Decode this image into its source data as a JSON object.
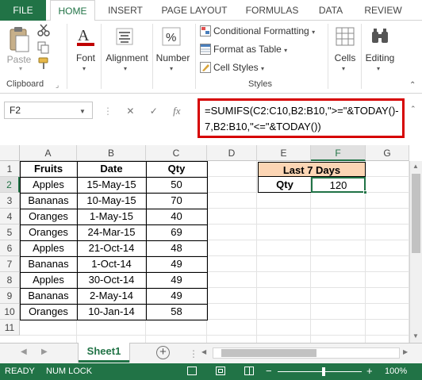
{
  "ribbon_tabs": [
    "FILE",
    "HOME",
    "INSERT",
    "PAGE LAYOUT",
    "FORMULAS",
    "DATA",
    "REVIEW"
  ],
  "active_tab": "HOME",
  "ribbon": {
    "paste_label": "Paste",
    "clipboard_label": "Clipboard",
    "font_label": "Font",
    "alignment_label": "Alignment",
    "number_label": "Number",
    "conditional_formatting": "Conditional Formatting",
    "format_as_table": "Format as Table",
    "cell_styles": "Cell Styles",
    "styles_label": "Styles",
    "cells_label": "Cells",
    "editing_label": "Editing"
  },
  "formula_bar": {
    "name_box": "F2",
    "fx_label": "fx",
    "formula_line1": "=SUMIFS(C2:C10,B2:B10,\">=\"&TODAY()-",
    "formula_line2": "7,B2:B10,\"<=\"&TODAY())"
  },
  "columns": [
    "A",
    "B",
    "C",
    "D",
    "E",
    "F",
    "G"
  ],
  "rows": [
    "1",
    "2",
    "3",
    "4",
    "5",
    "6",
    "7",
    "8",
    "9",
    "10",
    "11"
  ],
  "table": {
    "headers": [
      "Fruits",
      "Date",
      "Qty"
    ],
    "rows": [
      [
        "Apples",
        "15-May-15",
        "50"
      ],
      [
        "Bananas",
        "10-May-15",
        "70"
      ],
      [
        "Oranges",
        "1-May-15",
        "40"
      ],
      [
        "Oranges",
        "24-Mar-15",
        "69"
      ],
      [
        "Apples",
        "21-Oct-14",
        "48"
      ],
      [
        "Bananas",
        "1-Oct-14",
        "49"
      ],
      [
        "Apples",
        "30-Oct-14",
        "49"
      ],
      [
        "Bananas",
        "2-May-14",
        "49"
      ],
      [
        "Oranges",
        "10-Jan-14",
        "58"
      ]
    ]
  },
  "summary": {
    "title": "Last 7 Days",
    "label": "Qty",
    "value": "120",
    "title_bg": "#fcd5b4"
  },
  "sheet_tab": "Sheet1",
  "status": {
    "ready": "READY",
    "numlock": "NUM LOCK",
    "zoom": "100%",
    "minus": "−",
    "plus": "+"
  },
  "accent_color": "#217346",
  "highlight_color": "#d60000"
}
